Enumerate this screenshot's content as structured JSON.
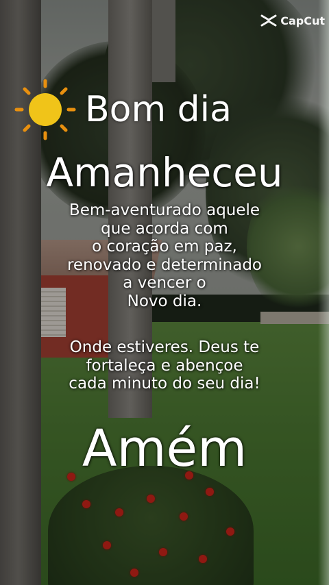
{
  "watermark": {
    "brand": "CapCut",
    "icon": "capcut-logo-icon"
  },
  "greeting": {
    "icon": "sun-icon",
    "text": "Bom dia",
    "sun_color": "#f0c419",
    "ray_color": "#e8900f"
  },
  "title": "Amanheceu",
  "message": {
    "paragraph1": [
      "Bem-aventurado aquele",
      "que acorda com",
      "o coração em paz,",
      "renovado e determinado",
      "a vencer o",
      "Novo dia."
    ],
    "paragraph2": [
      "Onde estiveres. Deus te",
      "fortaleça e abençoe",
      "cada minuto do seu dia!"
    ]
  },
  "closing": "Amém"
}
